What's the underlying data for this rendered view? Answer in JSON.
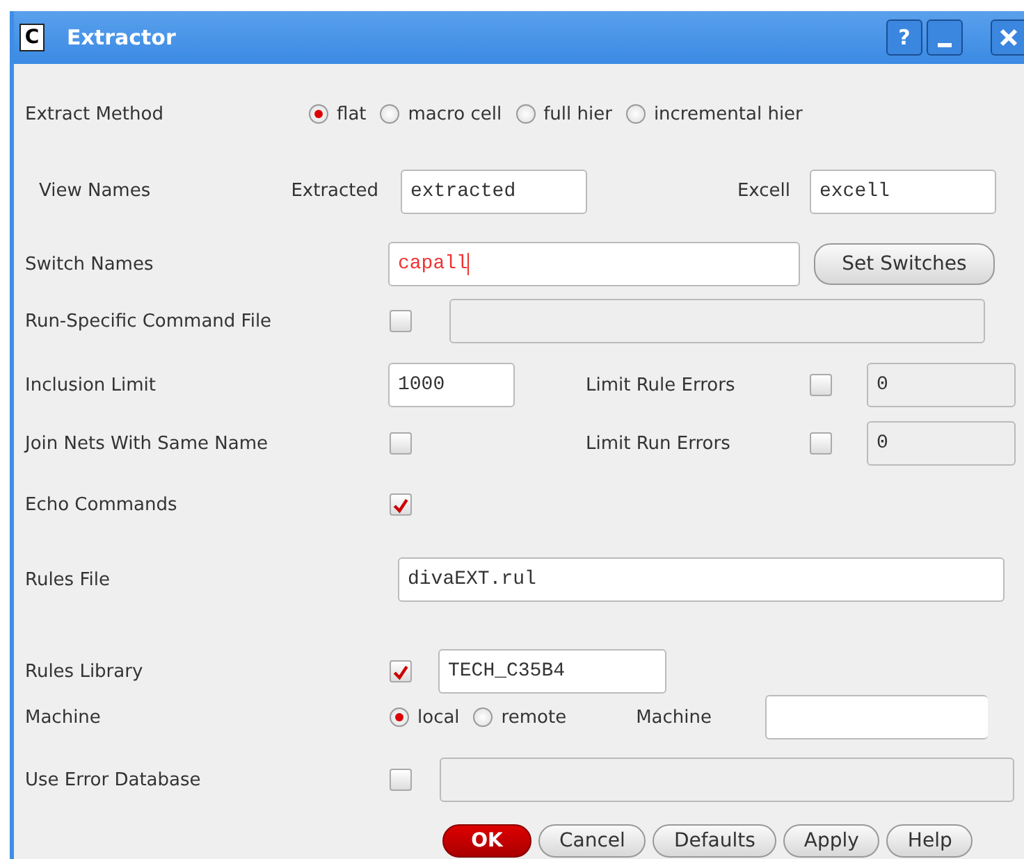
{
  "window": {
    "icon_letter": "C",
    "title": "Extractor",
    "help_button": "?"
  },
  "extract_method": {
    "label": "Extract Method",
    "options": [
      {
        "label": "flat",
        "selected": true
      },
      {
        "label": "macro cell",
        "selected": false
      },
      {
        "label": "full hier",
        "selected": false
      },
      {
        "label": "incremental hier",
        "selected": false
      }
    ]
  },
  "view_names": {
    "label": "View Names",
    "extracted": {
      "label": "Extracted",
      "value": "extracted"
    },
    "excell": {
      "label": "Excell",
      "value": "excell"
    }
  },
  "switch_names": {
    "label": "Switch Names",
    "value": "capall",
    "button": "Set Switches"
  },
  "run_specific_command_file": {
    "label": "Run-Specific Command File",
    "checked": false
  },
  "inclusion_limit": {
    "label": "Inclusion Limit",
    "value": "1000"
  },
  "limit_rule_errors": {
    "label": "Limit Rule Errors",
    "checked": false,
    "value": "0"
  },
  "join_nets": {
    "label": "Join Nets With Same Name",
    "checked": false
  },
  "limit_run_errors": {
    "label": "Limit Run Errors",
    "checked": false,
    "value": "0"
  },
  "echo_commands": {
    "label": "Echo Commands",
    "checked": true
  },
  "rules_file": {
    "label": "Rules File",
    "value": "divaEXT.rul"
  },
  "rules_library": {
    "label": "Rules Library",
    "checked": true,
    "value": "TECH_C35B4"
  },
  "machine": {
    "label": "Machine",
    "options": [
      {
        "label": "local",
        "selected": true
      },
      {
        "label": "remote",
        "selected": false
      }
    ],
    "field_label": "Machine"
  },
  "use_error_database": {
    "label": "Use Error Database",
    "checked": false
  },
  "buttons": [
    {
      "label": "OK",
      "kind": "primary"
    },
    {
      "label": "Cancel",
      "kind": "normal"
    },
    {
      "label": "Defaults",
      "kind": "normal"
    },
    {
      "label": "Apply",
      "kind": "normal"
    },
    {
      "label": "Help",
      "kind": "normal"
    }
  ]
}
